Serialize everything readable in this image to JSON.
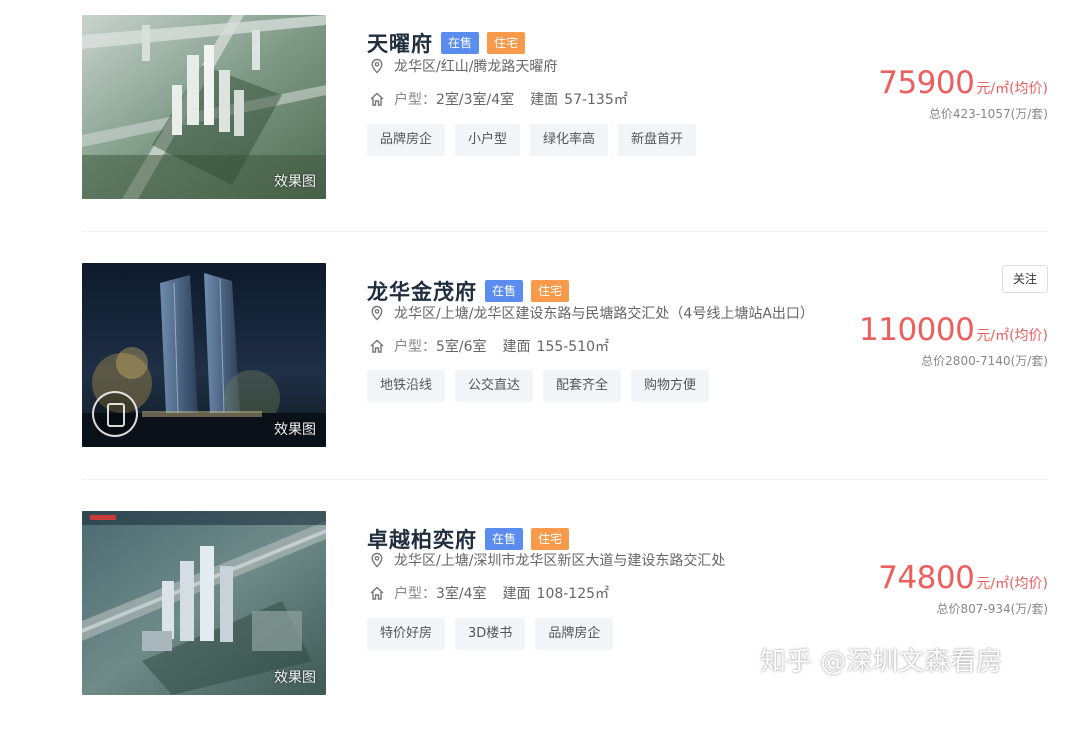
{
  "listings": [
    {
      "name": "天曜府",
      "status_badge": "在售",
      "type_badge": "住宅",
      "address": "龙华区/红山/腾龙路天曜府",
      "layout_label": "户型：",
      "layout": "2室/3室/4室",
      "area_label": "建面",
      "area": "57-135㎡",
      "tags": [
        "品牌房企",
        "小户型",
        "绿化率高",
        "新盘首开"
      ],
      "price": "75900",
      "price_unit": "元/㎡(均价)",
      "total_price": "总价423-1057(万/套)",
      "image_caption": "效果图",
      "image_desc": "aerial-green-district-towers"
    },
    {
      "name": "龙华金茂府",
      "status_badge": "在售",
      "type_badge": "住宅",
      "address": "龙华区/上塘/龙华区建设东路与民塘路交汇处（4号线上塘站A出口）",
      "layout_label": "户型：",
      "layout": "5室/6室",
      "area_label": "建面",
      "area": "155-510㎡",
      "tags": [
        "地铁沿线",
        "公交直达",
        "配套齐全",
        "购物方便"
      ],
      "price": "110000",
      "price_unit": "元/㎡(均价)",
      "total_price": "总价2800-7140(万/套)",
      "follow_label": "关注",
      "image_caption": "效果图",
      "image_desc": "night-towers-with-vr-icon"
    },
    {
      "name": "卓越柏奕府",
      "status_badge": "在售",
      "type_badge": "住宅",
      "address": "龙华区/上塘/深圳市龙华区新区大道与建设东路交汇处",
      "layout_label": "户型：",
      "layout": "3室/4室",
      "area_label": "建面",
      "area": "108-125㎡",
      "tags": [
        "特价好房",
        "3D楼书",
        "品牌房企"
      ],
      "price": "74800",
      "price_unit": "元/㎡(均价)",
      "total_price": "总价807-934(万/套)",
      "image_caption": "效果图",
      "image_desc": "aerial-district-highway"
    }
  ],
  "watermark": "知乎 @深圳文森看房",
  "colors": {
    "price": "#ec5f5f",
    "badge_blue": "#5b8def",
    "badge_orange": "#f79a4b",
    "tag_bg": "#f2f5f8",
    "title": "#1f2d3d"
  }
}
